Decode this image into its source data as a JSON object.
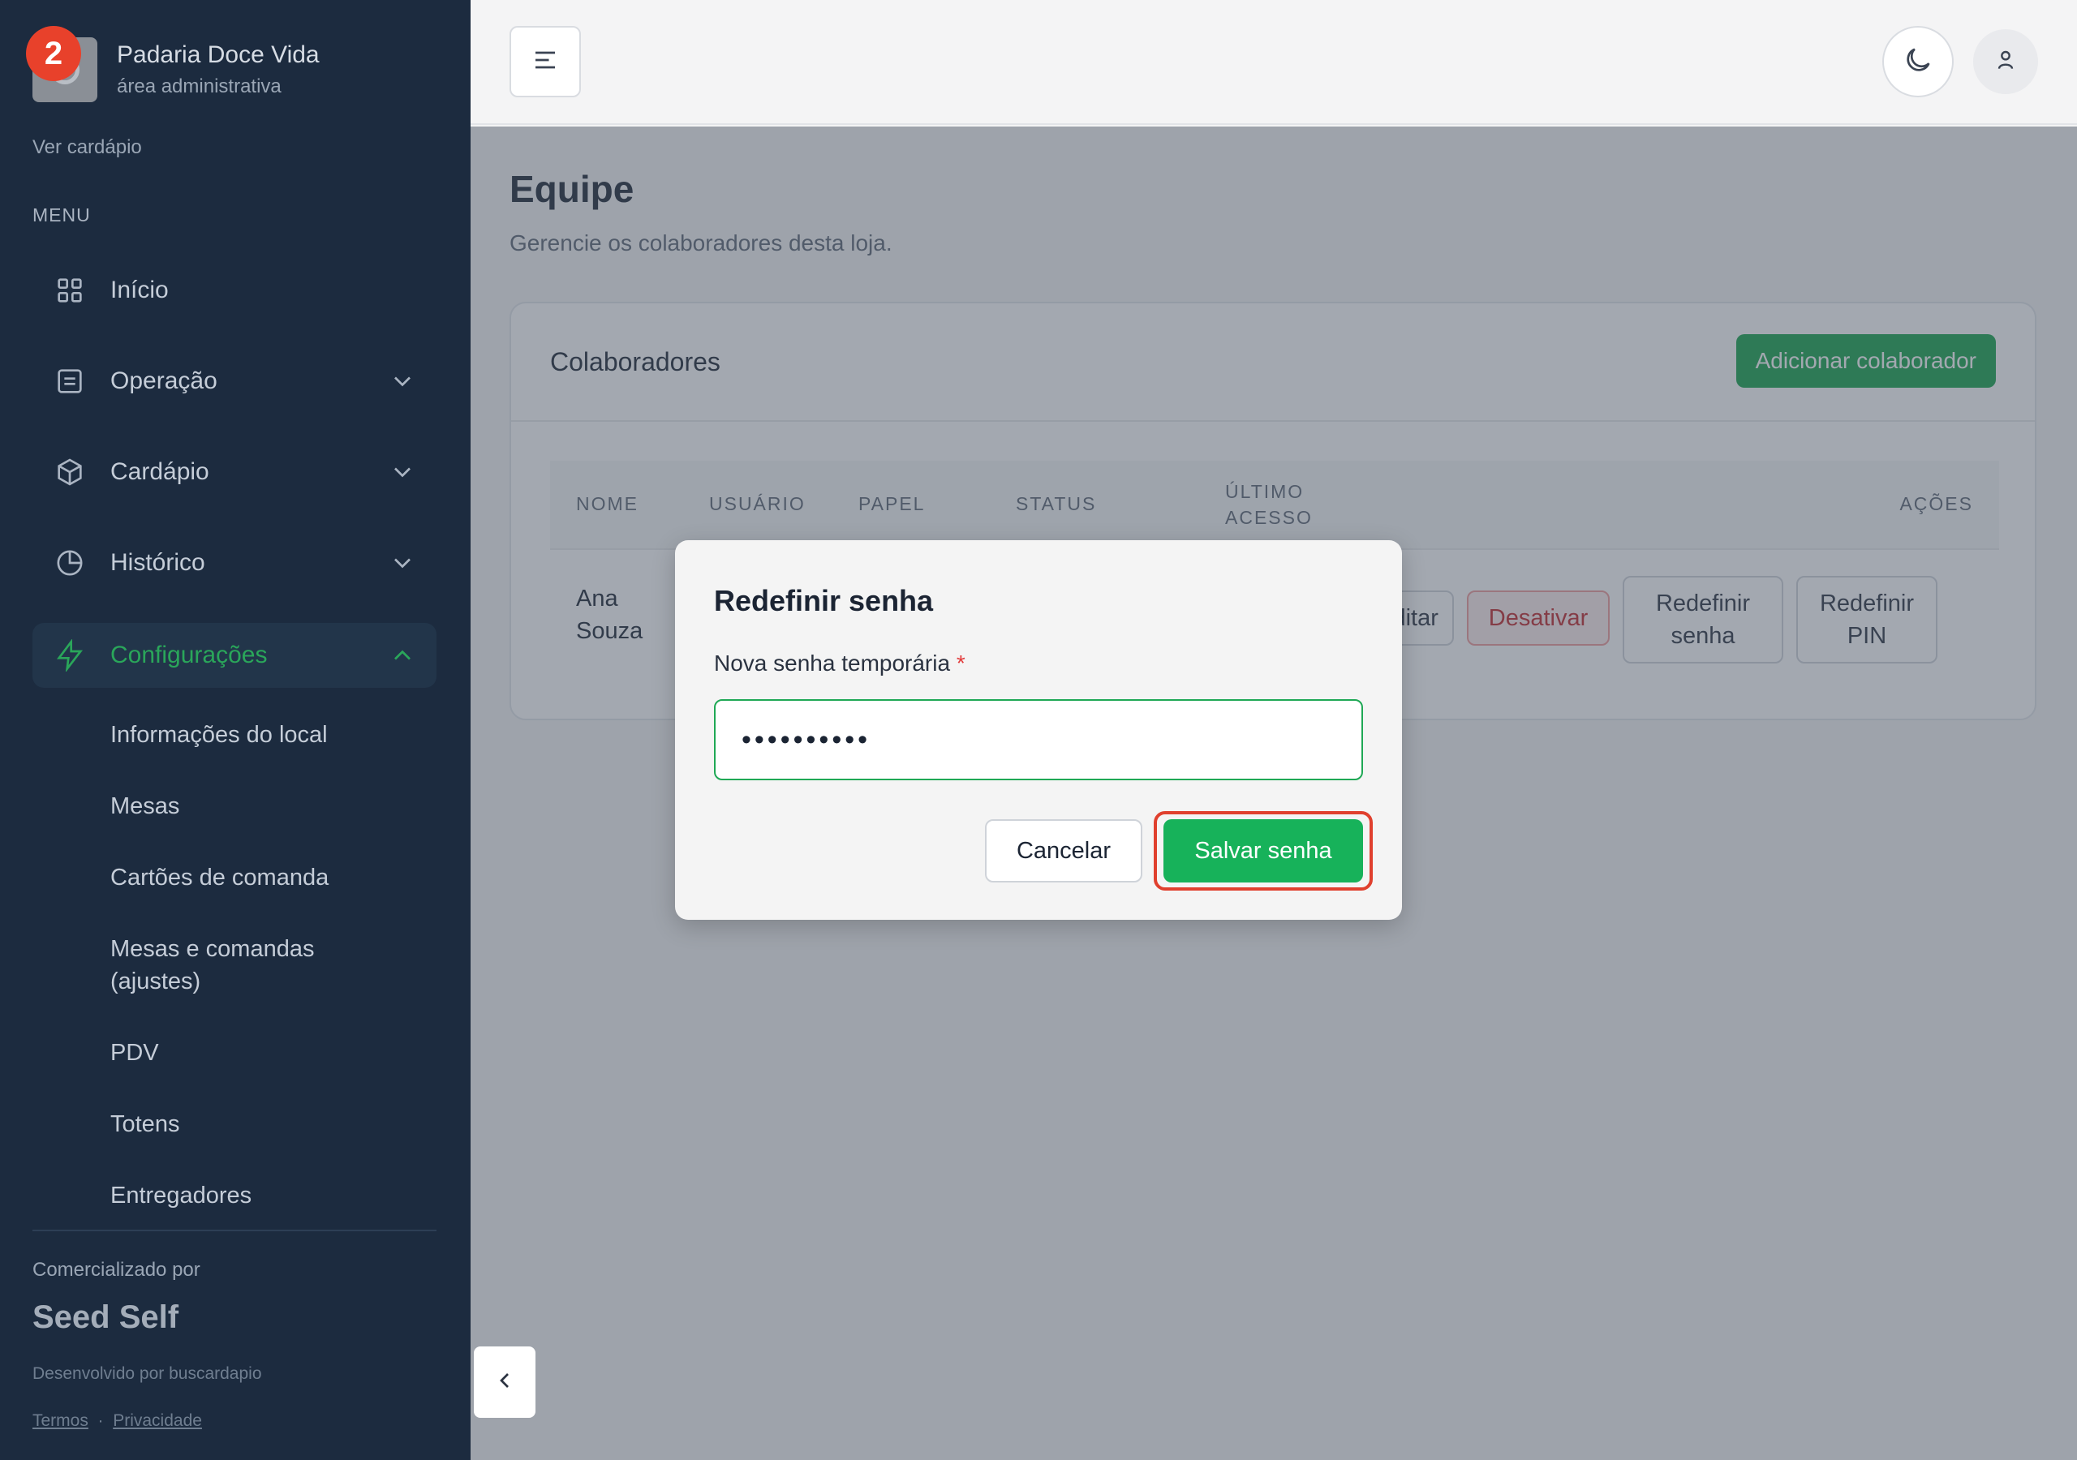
{
  "brand": {
    "name": "Padaria Doce Vida",
    "subtitle": "área administrativa",
    "badge": "2"
  },
  "sidebar": {
    "view_menu_link": "Ver cardápio",
    "menu_label": "MENU",
    "items": [
      {
        "label": "Início",
        "icon": "grid-icon"
      },
      {
        "label": "Operação",
        "icon": "list-icon"
      },
      {
        "label": "Cardápio",
        "icon": "box-icon"
      },
      {
        "label": "Histórico",
        "icon": "pie-chart-icon"
      },
      {
        "label": "Configurações",
        "icon": "bolt-icon",
        "active": true
      }
    ],
    "sub_items": [
      "Informações do local",
      "Mesas",
      "Cartões de comanda",
      "Mesas e comandas (ajustes)",
      "PDV",
      "Totens",
      "Entregadores"
    ],
    "footer": {
      "sold_by": "Comercializado por",
      "company": "Seed Self",
      "developed_by": "Desenvolvido por buscardapio",
      "terms": "Termos",
      "separator": "·",
      "privacy": "Privacidade"
    }
  },
  "page": {
    "title": "Equipe",
    "subtitle": "Gerencie os colaboradores desta loja."
  },
  "card": {
    "title": "Colaboradores",
    "add_button": "Adicionar colaborador",
    "columns": [
      "NOME",
      "USUÁRIO",
      "PAPEL",
      "STATUS",
      "ÚLTIMO ACESSO",
      "AÇÕES"
    ],
    "rows": [
      {
        "name": "Ana Souza",
        "actions": [
          "Editar",
          "Desativar",
          "Redefinir senha",
          "Redefinir PIN"
        ]
      }
    ]
  },
  "modal": {
    "title": "Redefinir senha",
    "field_label": "Nova senha temporária",
    "required_mark": "*",
    "password_value": "••••••••••",
    "cancel": "Cancelar",
    "save": "Salvar senha"
  },
  "colors": {
    "sidebar_bg": "#1c2b3f",
    "accent_green": "#17b25a",
    "highlight_red": "#e0402e",
    "danger": "#c0262b"
  }
}
